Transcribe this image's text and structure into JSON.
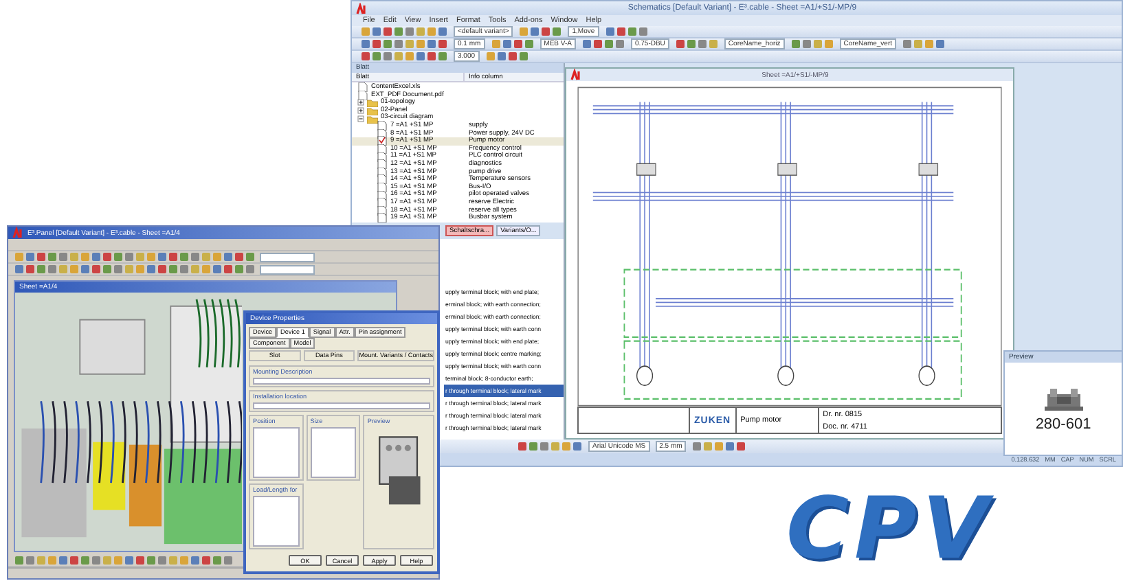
{
  "main_window": {
    "title": "Schematics [Default Variant] - E³.cable - Sheet =A1/+S1/-MP/9",
    "menu": [
      "File",
      "Edit",
      "View",
      "Insert",
      "Format",
      "Tools",
      "Add-ons",
      "Window",
      "Help"
    ],
    "toolbars": [
      [
        "<default variant>",
        "1,Move"
      ],
      [
        "0.1 mm",
        "MEB V-A",
        "0.75-DBU",
        "CoreName_horiz",
        "CoreName_vert"
      ],
      [
        "3.000"
      ]
    ],
    "tree_panel": {
      "title": "Blatt",
      "columns": [
        "Blatt",
        "Info column"
      ],
      "items": [
        {
          "kind": "file",
          "label": "ContentExcel.xls",
          "selected": false
        },
        {
          "kind": "file",
          "label": "EXT_PDF Document.pdf",
          "selected": false
        },
        {
          "kind": "folder",
          "label": "01-topology",
          "expanded": false,
          "selected": false
        },
        {
          "kind": "folder",
          "label": "02-Panel",
          "expanded": false,
          "selected": false
        },
        {
          "kind": "folder",
          "label": "03-circuit diagram",
          "expanded": true,
          "selected": false,
          "children": [
            {
              "kind": "sheet",
              "label": "7 =A1 +S1 MP",
              "info": "supply",
              "selected": false
            },
            {
              "kind": "sheet",
              "label": "8 =A1 +S1 MP",
              "info": "Power supply, 24V DC",
              "selected": false
            },
            {
              "kind": "sheet",
              "label": "9 =A1 +S1 MP",
              "info": "Pump motor",
              "selected": true
            },
            {
              "kind": "sheet",
              "label": "10 =A1 +S1 MP",
              "info": "Frequency control",
              "selected": false
            },
            {
              "kind": "sheet",
              "label": "11 =A1 +S1 MP",
              "info": "PLC control circuit",
              "selected": false
            },
            {
              "kind": "sheet",
              "label": "12 =A1 +S1 MP",
              "info": "diagnostics",
              "selected": false
            },
            {
              "kind": "sheet",
              "label": "13 =A1 +S1 MP",
              "info": "pump drive",
              "selected": false
            },
            {
              "kind": "sheet",
              "label": "14 =A1 +S1 MP",
              "info": "Temperature sensors",
              "selected": false
            },
            {
              "kind": "sheet",
              "label": "15 =A1 +S1 MP",
              "info": "Bus-I/O",
              "selected": false
            },
            {
              "kind": "sheet",
              "label": "16 =A1 +S1 MP",
              "info": "pilot operated valves",
              "selected": false
            },
            {
              "kind": "sheet",
              "label": "17 =A1 +S1 MP",
              "info": "reserve Electric",
              "selected": false
            },
            {
              "kind": "sheet",
              "label": "18 =A1 +S1 MP",
              "info": "reserve all types",
              "selected": false
            },
            {
              "kind": "sheet",
              "label": "19 =A1 +S1 MP",
              "info": "Busbar system",
              "selected": false
            }
          ]
        }
      ]
    },
    "panel_tabs": [
      {
        "label": "Schaltschra...",
        "selected": true
      },
      {
        "label": "Variants/O...",
        "selected": false
      }
    ],
    "component_list": [
      {
        "text": "upply terminal block; with end plate;",
        "selected": false
      },
      {
        "text": "erminal block; with earth connection;",
        "selected": false
      },
      {
        "text": "erminal block; with earth connection;",
        "selected": false
      },
      {
        "text": "upply terminal block; with earth conn",
        "selected": false
      },
      {
        "text": "upply terminal block; with end plate;",
        "selected": false
      },
      {
        "text": "upply terminal block; centre marking;",
        "selected": false
      },
      {
        "text": "upply terminal block; with earth conn",
        "selected": false
      },
      {
        "text": "terminal block; 8-conductor earth;",
        "selected": false
      },
      {
        "text": "r through terminal block; lateral mark",
        "selected": true
      },
      {
        "text": "r through terminal block; lateral mark",
        "selected": false
      },
      {
        "text": "r through terminal block; lateral mark",
        "selected": false
      },
      {
        "text": "r through terminal block; lateral mark",
        "selected": false
      }
    ],
    "sheet_window": {
      "title": "Sheet =A1/+S1/-MP/9",
      "title_block": {
        "company": "ZUKEN",
        "description": "Pump motor",
        "drawing_number": "Dr. nr. 0815",
        "document_number": "Doc. nr. 4711"
      }
    },
    "format_bar": {
      "font": "Arial Unicode MS",
      "size": "2.5 mm"
    },
    "status_bar": [
      "0.128.632",
      "MM",
      "CAP",
      "NUM",
      "SCRL"
    ]
  },
  "preview_panel": {
    "title": "Preview",
    "part_number": "280-601"
  },
  "panel_window": {
    "title": "E³.Panel [Default Variant] - E³.cable - Sheet =A1/4",
    "sheet_title": "Sheet =A1/4",
    "dialog": {
      "title": "Device Properties",
      "tabs": [
        {
          "label": "Device",
          "selected": false
        },
        {
          "label": "Device 1",
          "selected": true
        },
        {
          "label": "Signal",
          "selected": false
        },
        {
          "label": "Attr.",
          "selected": false
        },
        {
          "label": "Pin assignment",
          "selected": false
        },
        {
          "label": "Component",
          "selected": false
        },
        {
          "label": "Model",
          "selected": false
        }
      ],
      "subtabs": [
        "Slot",
        "Data Pins",
        "Mount. Variants / Contacts"
      ],
      "groups": [
        "Mounting Description",
        "Installation location",
        "Position",
        "Size",
        "Load/Length for",
        "Preview"
      ],
      "buttons": [
        "OK",
        "Cancel",
        "Apply",
        "Help"
      ]
    }
  },
  "logo": {
    "text": "CPV"
  }
}
